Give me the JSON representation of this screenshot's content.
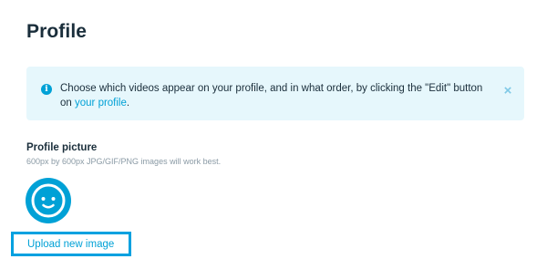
{
  "header": {
    "title": "Profile"
  },
  "notice": {
    "text_before_link": "Choose which videos appear on your profile, and in what order, by clicking the \"Edit\" button on ",
    "link_text": "your profile",
    "text_after_link": ".",
    "icon": "info-icon",
    "close_icon": "close-icon",
    "close_glyph": "×",
    "info_glyph": "i"
  },
  "profile_picture": {
    "label": "Profile picture",
    "hint": "600px by 600px JPG/GIF/PNG images will work best.",
    "avatar_icon": "smiley-face-icon",
    "upload_label": "Upload new image"
  },
  "colors": {
    "accent": "#00a1d6",
    "notice_background": "#e6f7fc",
    "title_text": "#1a2e3b",
    "hint_text": "#8a9aa5"
  }
}
